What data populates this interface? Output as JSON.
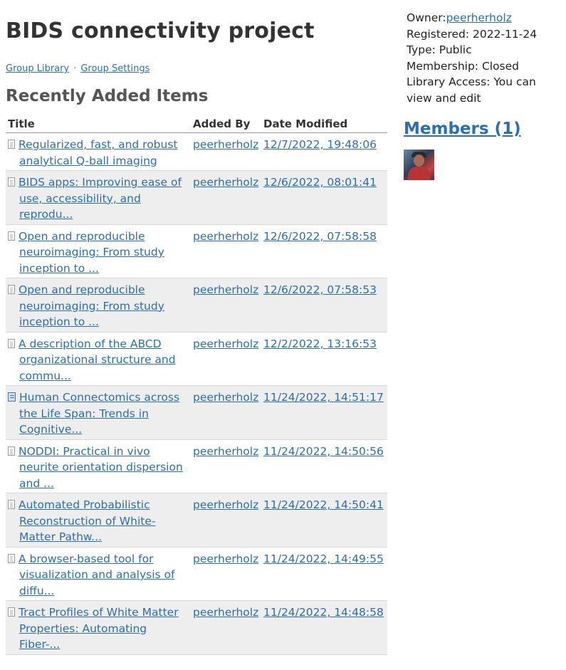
{
  "group": {
    "title": "BIDS connectivity project",
    "links": {
      "library": "Group Library",
      "settings": "Group Settings",
      "separator": "·"
    }
  },
  "recent": {
    "heading": "Recently Added Items",
    "columns": {
      "title": "Title",
      "added_by": "Added By",
      "date": "Date Modified"
    },
    "rows": [
      {
        "icon": "document-icon",
        "title": "Regularized, fast, and robust analytical Q-ball imaging",
        "added_by": "peerherholz",
        "date": "12/7/2022, 19:48:06"
      },
      {
        "icon": "document-icon",
        "title": "BIDS apps: Improving ease of use, accessibility, and reprodu...",
        "added_by": "peerherholz",
        "date": "12/6/2022, 08:01:41"
      },
      {
        "icon": "document-icon",
        "title": "Open and reproducible neuroimaging: From study inception to ...",
        "added_by": "peerherholz",
        "date": "12/6/2022, 07:58:58"
      },
      {
        "icon": "document-icon",
        "title": "Open and reproducible neuroimaging: From study inception to ...",
        "added_by": "peerherholz",
        "date": "12/6/2022, 07:58:53"
      },
      {
        "icon": "document-icon",
        "title": "A description of the ABCD organizational structure and commu...",
        "added_by": "peerherholz",
        "date": "12/2/2022, 13:16:53"
      },
      {
        "icon": "book-icon",
        "title": "Human Connectomics across the Life Span: Trends in Cognitive...",
        "added_by": "peerherholz",
        "date": "11/24/2022, 14:51:17"
      },
      {
        "icon": "document-icon",
        "title": "NODDI: Practical in vivo neurite orientation dispersion and ...",
        "added_by": "peerherholz",
        "date": "11/24/2022, 14:50:56"
      },
      {
        "icon": "document-icon",
        "title": "Automated Probabilistic Reconstruction of White-Matter Pathw...",
        "added_by": "peerherholz",
        "date": "11/24/2022, 14:50:41"
      },
      {
        "icon": "document-icon",
        "title": "A browser-based tool for visualization and analysis of diffu...",
        "added_by": "peerherholz",
        "date": "11/24/2022, 14:49:55"
      },
      {
        "icon": "document-icon",
        "title": "Tract Profiles of White Matter Properties: Automating Fiber-...",
        "added_by": "peerherholz",
        "date": "11/24/2022, 14:48:58"
      }
    ]
  },
  "sidebar": {
    "owner_label": "Owner:",
    "owner": "peerherholz",
    "registered": "Registered: 2022-11-24",
    "type": "Type: Public",
    "membership": "Membership: Closed",
    "library_access": "Library Access: You can view and edit",
    "members_heading": "Members (1)"
  },
  "colors": {
    "link": "#2a6eb6",
    "row_alt": "#eeeeee",
    "heading": "#333333"
  }
}
